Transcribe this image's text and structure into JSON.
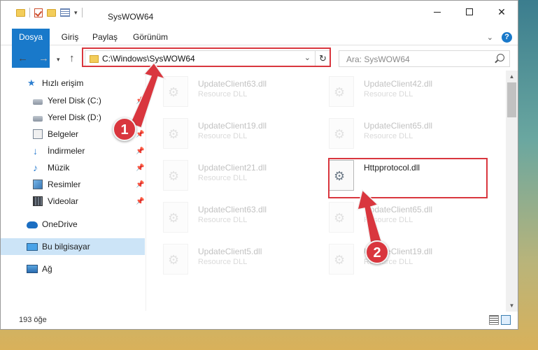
{
  "window": {
    "title": "SysWOW64"
  },
  "ribbon": {
    "tabs": [
      "Dosya",
      "Giriş",
      "Paylaş",
      "Görünüm"
    ]
  },
  "address": {
    "path": "C:\\Windows\\SysWOW64"
  },
  "search": {
    "placeholder": "Ara: SysWOW64"
  },
  "sidebar": {
    "items": [
      {
        "label": "Hızlı erişim",
        "icon": "star-icon"
      },
      {
        "label": "Yerel Disk (C:)",
        "icon": "drive-icon"
      },
      {
        "label": "Yerel Disk (D:)",
        "icon": "drive-icon"
      },
      {
        "label": "Belgeler",
        "icon": "documents-icon"
      },
      {
        "label": "İndirmeler",
        "icon": "download-icon"
      },
      {
        "label": "Müzik",
        "icon": "music-icon"
      },
      {
        "label": "Resimler",
        "icon": "pictures-icon"
      },
      {
        "label": "Videolar",
        "icon": "videos-icon"
      },
      {
        "label": "OneDrive",
        "icon": "cloud-icon"
      },
      {
        "label": "Bu bilgisayar",
        "icon": "computer-icon"
      },
      {
        "label": "Ağ",
        "icon": "network-icon"
      }
    ]
  },
  "files": [
    {
      "name": "UpdateClient63.dll",
      "desc": "Resource DLL"
    },
    {
      "name": "UpdateClient42.dll",
      "desc": "Resource DLL"
    },
    {
      "name": "UpdateClient19.dll",
      "desc": "Resource DLL"
    },
    {
      "name": "UpdateClient65.dll",
      "desc": "Resource DLL"
    },
    {
      "name": "UpdateClient21.dll",
      "desc": "Resource DLL"
    },
    {
      "name": "Httpprotocol.dll",
      "desc": ""
    },
    {
      "name": "UpdateClient63.dll",
      "desc": "Resource DLL"
    },
    {
      "name": "UpdateClient65.dll",
      "desc": "Resource DLL"
    },
    {
      "name": "UpdateClient5.dll",
      "desc": "Resource DLL"
    },
    {
      "name": "UpdateClient19.dll",
      "desc": "Resource DLL"
    }
  ],
  "status": {
    "count": "193 öğe"
  },
  "annotations": {
    "badge1": "1",
    "badge2": "2",
    "color": "#d9363e"
  }
}
